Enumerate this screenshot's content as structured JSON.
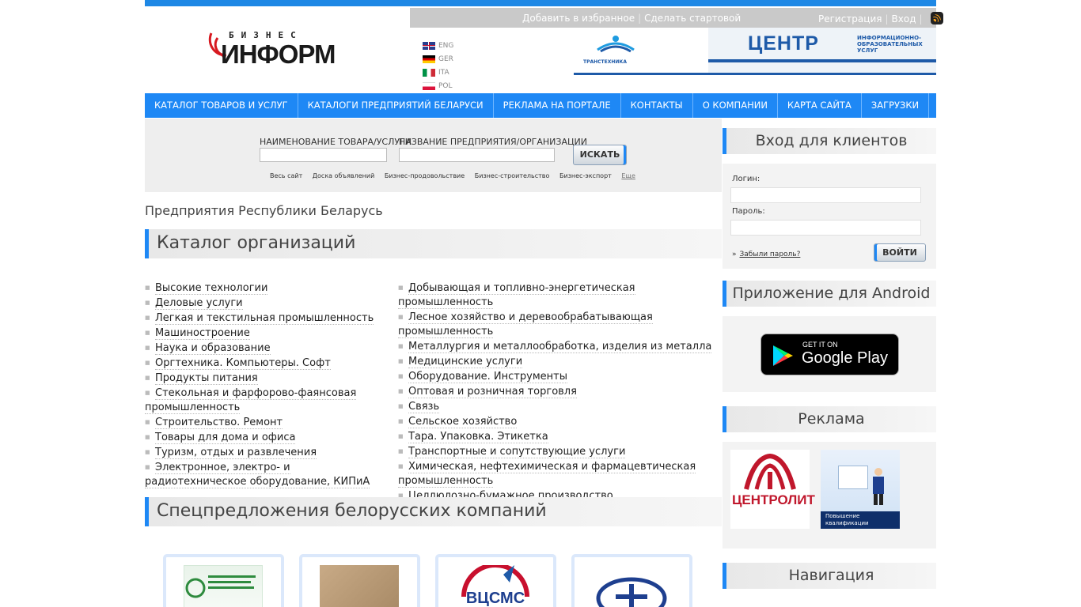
{
  "header": {
    "logo": {
      "top": "БИЗНЕС",
      "main": "ИНФОРМ"
    },
    "userbar": {
      "add_favorites": "Добавить в избранное",
      "make_home": "Сделать стартовой",
      "register": "Регистрация",
      "login": "Вход"
    },
    "languages": [
      "ENG",
      "GER",
      "ITA",
      "POL"
    ],
    "banner": {
      "org": "ТРАНСТЕХНИКА",
      "title": "ЦЕНТР",
      "subtitle": "ИНФОРМАЦИОННО-ОБРАЗОВАТЕЛЬНЫХ УСЛУГ"
    }
  },
  "nav": [
    "КАТАЛОГ ТОВАРОВ И УСЛУГ",
    "КАТАЛОГИ ПРЕДПРИЯТИЙ БЕЛАРУСИ",
    "РЕКЛАМА НА ПОРТАЛЕ",
    "КОНТАКТЫ",
    "О КОМПАНИИ",
    "КАРТА САЙТА",
    "ЗАГРУЗКИ"
  ],
  "search": {
    "product_label": "НАИМЕНОВАНИЕ ТОВАРА/УСЛУГИ",
    "company_label": "НАЗВАНИЕ ПРЕДПРИЯТИЯ/ОРГАНИЗАЦИИ",
    "button": "ИСКАТЬ",
    "quick_links": [
      "Весь сайт",
      "Доска объявлений",
      "Бизнес-продовольствие",
      "Бизнес-строительство",
      "Бизнес-экспорт"
    ],
    "more": "Еще"
  },
  "main": {
    "breadcrumb": "Предприятия Республики Беларусь",
    "catalog_title": "Каталог организаций",
    "catalog_left": [
      "Высокие технологии",
      "Деловые услуги",
      "Легкая и текстильная промышленность",
      "Машиностроение",
      "Наука и образование",
      "Оргтехника. Компьютеры. Софт",
      "Продукты питания",
      "Стекольная и фарфорово-фаянсовая промышленность",
      "Строительство. Ремонт",
      "Товары для дома и офиса",
      "Туризм, отдых и развлечения",
      "Электронное, электро- и радиотехническое оборудование, КИПиА"
    ],
    "catalog_right": [
      "Добывающая и топливно-энергетическая промышленность",
      "Лесное хозяйство и деревообрабатывающая промышленность",
      "Металлургия и металлообработка, изделия из металла",
      "Медицинские услуги",
      "Оборудование. Инструменты",
      "Оптовая и розничная торговля",
      "Связь",
      "Сельское хозяйство",
      "Тара. Упаковка. Этикетка",
      "Транспортные и сопутствующие услуги",
      "Химическая, нефтехимическая и фармацевтическая промышленность",
      "Целлюлозно-бумажное производство"
    ],
    "offers_title": "Спецпредложения белорусских компаний",
    "offer_logo_text": "ВЦСМС"
  },
  "sidebar": {
    "login_title": "Вход для клиентов",
    "login_label": "Логин:",
    "password_label": "Пароль:",
    "forgot": "Забыли пароль?",
    "login_button": "ВОЙТИ",
    "android_title": "Приложение для Android",
    "gplay_top": "GET IT ON",
    "gplay_main": "Google Play",
    "ads_title": "Реклама",
    "ad1_text": "ЦЕНТРОЛИТ",
    "ad2_text": "Повышение квалификации",
    "nav_title": "Навигация"
  },
  "colors": {
    "accent": "#1e88f5",
    "brand_red": "#c0172c"
  }
}
